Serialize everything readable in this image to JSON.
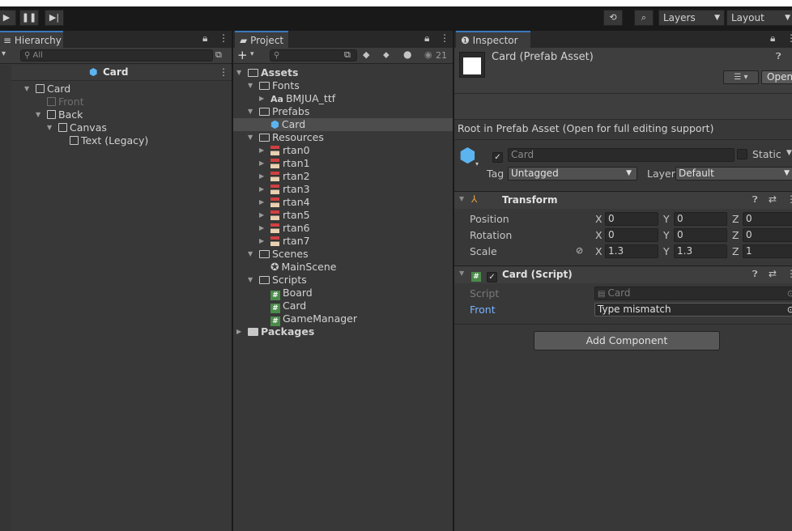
{
  "toolbar": {
    "play": "▶",
    "pause": "❚❚",
    "step": "▶|",
    "layers_label": "Layers",
    "layout_label": "Layout"
  },
  "hierarchy": {
    "tab_label": "Hierarchy",
    "search_placeholder": "All",
    "header": "Card",
    "items": [
      {
        "label": "Card"
      },
      {
        "label": "Front"
      },
      {
        "label": "Back"
      },
      {
        "label": "Canvas"
      },
      {
        "label": "Text (Legacy)"
      }
    ]
  },
  "project": {
    "tab_label": "Project",
    "hidden_count": "21",
    "items": [
      {
        "label": "Assets"
      },
      {
        "label": "Fonts"
      },
      {
        "label": "BMJUA_ttf",
        "prefix": "Aa"
      },
      {
        "label": "Prefabs"
      },
      {
        "label": "Card"
      },
      {
        "label": "Resources"
      },
      {
        "label": "rtan0"
      },
      {
        "label": "rtan1"
      },
      {
        "label": "rtan2"
      },
      {
        "label": "rtan3"
      },
      {
        "label": "rtan4"
      },
      {
        "label": "rtan5"
      },
      {
        "label": "rtan6"
      },
      {
        "label": "rtan7"
      },
      {
        "label": "Scenes"
      },
      {
        "label": "MainScene"
      },
      {
        "label": "Scripts"
      },
      {
        "label": "Board"
      },
      {
        "label": "Card"
      },
      {
        "label": "GameManager"
      },
      {
        "label": "Packages"
      }
    ]
  },
  "inspector": {
    "tab_label": "Inspector",
    "asset_title": "Card (Prefab Asset)",
    "open_label": "Open",
    "root_note": "Root in Prefab Asset (Open for full editing support)",
    "name_value": "Card",
    "static_label": "Static",
    "tag_label": "Tag",
    "tag_value": "Untagged",
    "layer_label": "Layer",
    "layer_value": "Default",
    "transform": {
      "title": "Transform",
      "position_label": "Position",
      "rotation_label": "Rotation",
      "scale_label": "Scale",
      "x": "X",
      "y": "Y",
      "z": "Z",
      "position": [
        "0",
        "0",
        "0"
      ],
      "rotation": [
        "0",
        "0",
        "0"
      ],
      "scale": [
        "1.3",
        "1.3",
        "1"
      ]
    },
    "card_script": {
      "title": "Card (Script)",
      "script_label": "Script",
      "script_value": "Card",
      "front_label": "Front",
      "front_value": "Type mismatch"
    },
    "add_component_label": "Add Component"
  },
  "colors": {
    "panel": "#383838",
    "toolbar": "#191919",
    "selection": "#4d4d4d",
    "link_blue": "#7ab3ff",
    "accent": "#3a79bb",
    "prefab_blue": "#5bb4f0"
  }
}
